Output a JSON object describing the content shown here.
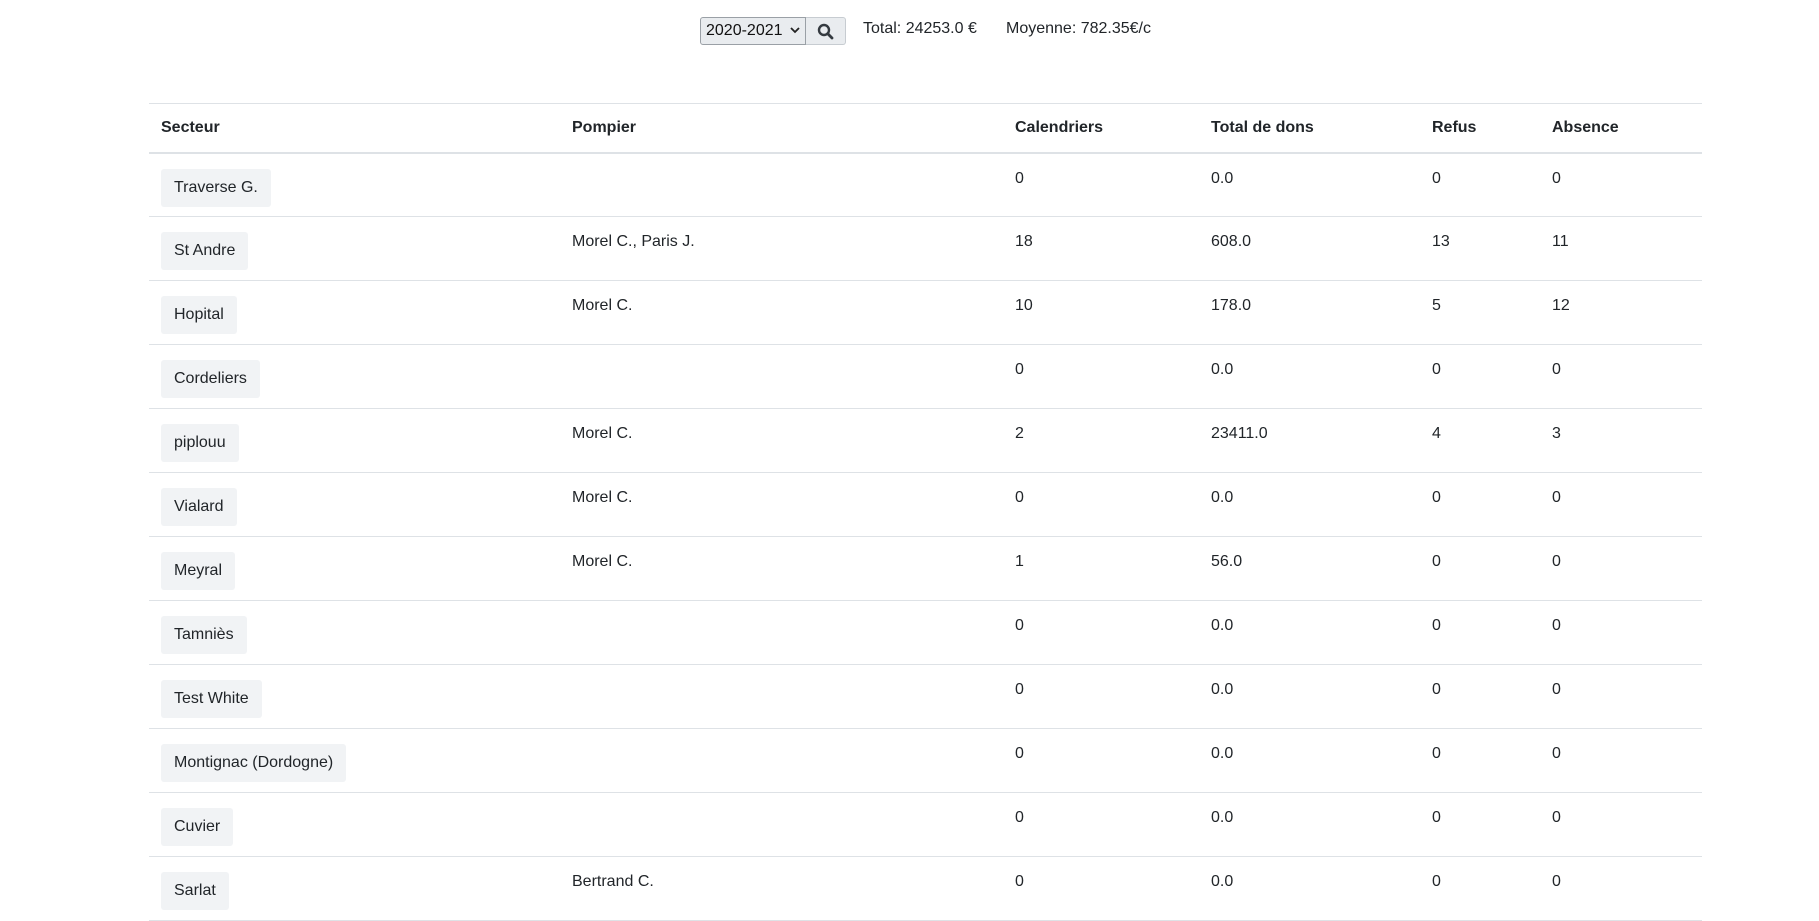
{
  "filter": {
    "selected_year": "2020-2021",
    "total_text": "Total: 24253.0 €",
    "moyenne_text": "Moyenne: 782.35€/c"
  },
  "table": {
    "headers": {
      "secteur": "Secteur",
      "pompier": "Pompier",
      "calendriers": "Calendriers",
      "total": "Total de dons",
      "refus": "Refus",
      "absence": "Absence"
    },
    "rows": [
      {
        "secteur": "Traverse G.",
        "pompier": "",
        "calendriers": "0",
        "total": "0.0",
        "refus": "0",
        "absence": "0"
      },
      {
        "secteur": "St Andre",
        "pompier": "Morel C., Paris J.",
        "calendriers": "18",
        "total": "608.0",
        "refus": "13",
        "absence": "11"
      },
      {
        "secteur": "Hopital",
        "pompier": "Morel C.",
        "calendriers": "10",
        "total": "178.0",
        "refus": "5",
        "absence": "12"
      },
      {
        "secteur": "Cordeliers",
        "pompier": "",
        "calendriers": "0",
        "total": "0.0",
        "refus": "0",
        "absence": "0"
      },
      {
        "secteur": "piplouu",
        "pompier": "Morel C.",
        "calendriers": "2",
        "total": "23411.0",
        "refus": "4",
        "absence": "3"
      },
      {
        "secteur": "Vialard",
        "pompier": "Morel C.",
        "calendriers": "0",
        "total": "0.0",
        "refus": "0",
        "absence": "0"
      },
      {
        "secteur": "Meyral",
        "pompier": "Morel C.",
        "calendriers": "1",
        "total": "56.0",
        "refus": "0",
        "absence": "0"
      },
      {
        "secteur": "Tamniès",
        "pompier": "",
        "calendriers": "0",
        "total": "0.0",
        "refus": "0",
        "absence": "0"
      },
      {
        "secteur": "Test White",
        "pompier": "",
        "calendriers": "0",
        "total": "0.0",
        "refus": "0",
        "absence": "0"
      },
      {
        "secteur": "Montignac (Dordogne)",
        "pompier": "",
        "calendriers": "0",
        "total": "0.0",
        "refus": "0",
        "absence": "0"
      },
      {
        "secteur": "Cuvier",
        "pompier": "",
        "calendriers": "0",
        "total": "0.0",
        "refus": "0",
        "absence": "0"
      },
      {
        "secteur": "Sarlat",
        "pompier": "Bertrand C.",
        "calendriers": "0",
        "total": "0.0",
        "refus": "0",
        "absence": "0"
      }
    ]
  }
}
